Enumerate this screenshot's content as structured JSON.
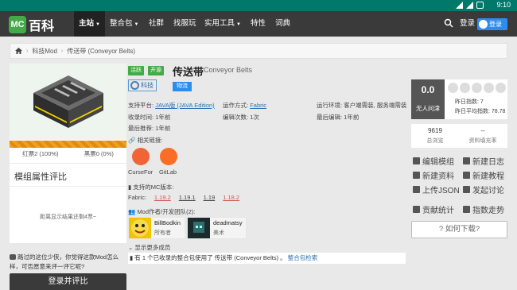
{
  "statusbar": {
    "time": "9:10"
  },
  "nav": {
    "logo_badge": "MC",
    "logo_text": "百科",
    "items": [
      {
        "label": "主站",
        "caret": true,
        "active": true
      },
      {
        "label": "整合包",
        "caret": true
      },
      {
        "label": "社群"
      },
      {
        "label": "找服玩"
      },
      {
        "label": "实用工具",
        "caret": true
      },
      {
        "label": "特性"
      },
      {
        "label": "词典"
      }
    ],
    "login": "登录",
    "qq_login": "登录"
  },
  "breadcrumb": [
    "科技Mod",
    "传送带 (Conveyor Belts)"
  ],
  "left": {
    "red_votes": "红票2 (100%)",
    "black_votes": "黑票0 (0%)",
    "rating_title": "模组属性评比",
    "rating_empty": "距离显示结果还剩4票~",
    "tip": "路过的这位少侠，你觉得这款Mod怎么样，可否愿意来评一评它呢?",
    "login_button": "登录并评比"
  },
  "main": {
    "tags": [
      "活跃",
      "开源"
    ],
    "title": "传送带",
    "subtitle": "Conveyor Belts",
    "category": "科技",
    "category_sub": "物流",
    "meta": {
      "platform_label": "支持平台:",
      "platform_value": "JAVA版 (JAVA Edition)",
      "runmode_label": "运作方式:",
      "runmode_value": "Fabric",
      "env": "运行环境: 客户端需装, 服务端需装",
      "recorded": "收录时间: 1年前",
      "edits": "编辑次数: 1次",
      "last_edit": "最后编辑: 1年前",
      "last_recommend": "最后推荐: 1年前"
    },
    "related_label": "相关链接:",
    "links": [
      "CurseFor",
      "GitLab"
    ],
    "versions_label": "支持的MC版本:",
    "loader": "Fabric:",
    "versions": [
      {
        "v": "1.19.2",
        "red": true
      },
      {
        "v": "1.19.1",
        "red": false
      },
      {
        "v": "1.19",
        "red": false
      },
      {
        "v": "1.18.2",
        "red": true
      }
    ],
    "authors_label": "Mod作者/开发团队(2):",
    "authors": [
      {
        "name": "BillBodkin",
        "role": "所有者"
      },
      {
        "name": "deadmatsy",
        "role": "美术"
      }
    ],
    "more_members": "显示更多成员",
    "pack_note": "有 1 个已收录的整合包使用了 传送带 (Conveyor Belts) 。",
    "pack_link": "整合包检索"
  },
  "right": {
    "score": "0.0",
    "score_label": "无人问津",
    "yesterday_index": "昨日指数: 7",
    "yesterday_avg": "昨日平均指数: 78.78",
    "views": "9619",
    "views_label": "总浏览",
    "fill_rate": "--",
    "fill_rate_label": "资料填充率",
    "actions": [
      "编辑模组",
      "新建日志",
      "新建资料",
      "新建教程",
      "上传JSON",
      "发起讨论",
      "贡献统计",
      "指数走势"
    ],
    "how_download": "如何下载?"
  }
}
